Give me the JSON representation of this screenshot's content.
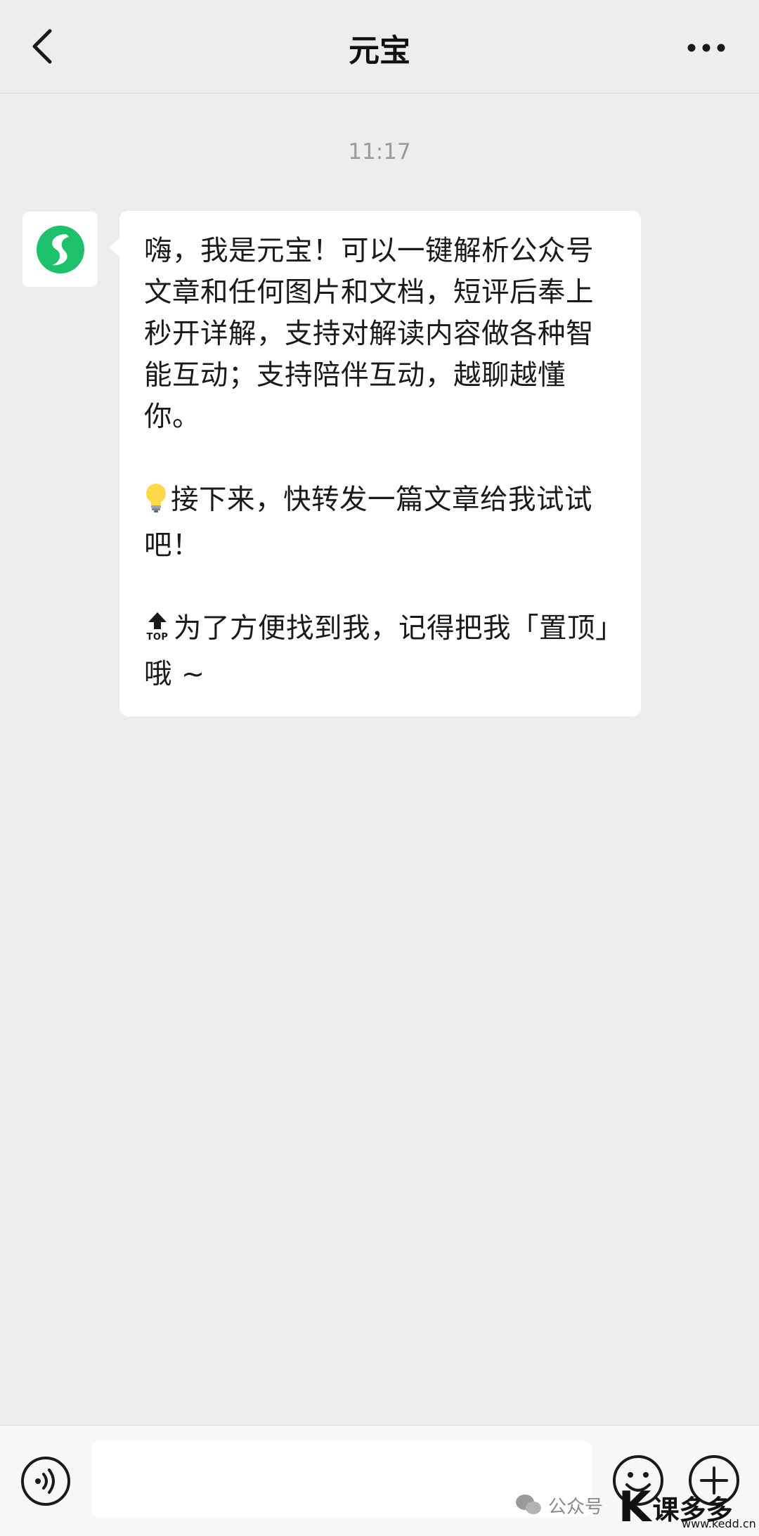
{
  "header": {
    "back_icon": "chevron-left-icon",
    "title": "元宝",
    "more_icon": "more-dots-icon"
  },
  "chat": {
    "timestamp": "11:17",
    "message": {
      "avatar_icon": "yuanbao-logo-icon",
      "paragraphs": [
        {
          "emoji": "",
          "text": "嗨，我是元宝！可以一键解析公众号文章和任何图片和文档，短评后奉上秒开详解，支持对解读内容做各种智能互动；支持陪伴互动，越聊越懂你。"
        },
        {
          "emoji": "lightbulb-emoji",
          "text": "接下来，快转发一篇文章给我试试吧！"
        },
        {
          "emoji": "top-arrow-emoji",
          "emoji_label": "TOP",
          "text": "为了方便找到我，记得把我「置顶」哦 ~"
        }
      ]
    }
  },
  "bottom_bar": {
    "voice_icon": "voice-icon",
    "input_value": "",
    "emoji_icon": "emoji-icon",
    "plus_icon": "plus-icon"
  },
  "watermark": {
    "wechat_icon": "wechat-icon",
    "label": "公众号",
    "brand": "课多多",
    "url": "www.kedd.cn"
  },
  "colors": {
    "background": "#ededed",
    "bubble": "#ffffff",
    "brand_green": "#1fc06b"
  }
}
